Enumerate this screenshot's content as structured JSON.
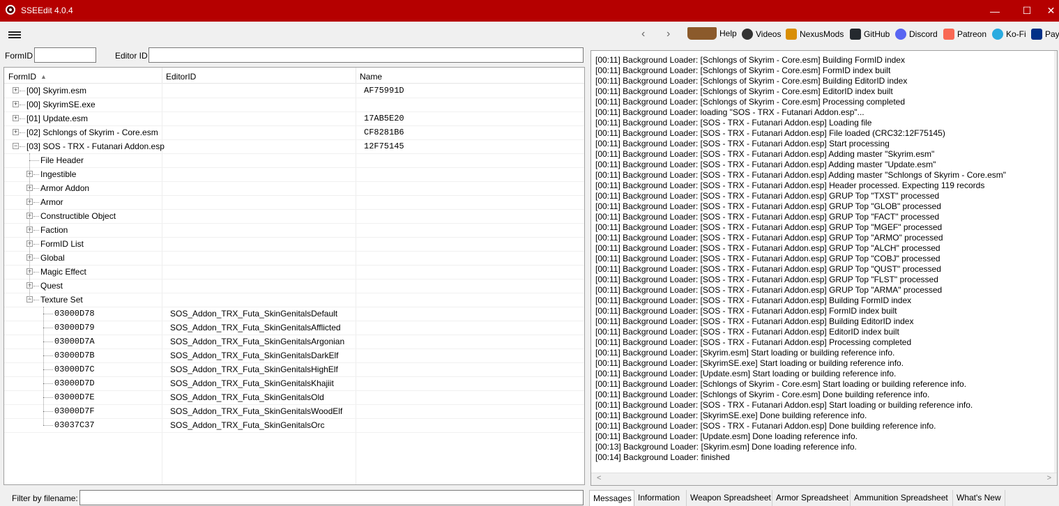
{
  "window": {
    "title": "SSEEdit 4.0.4",
    "minimize_label": "—",
    "maximize_label": "☐",
    "close_label": "✕"
  },
  "toolbar": {
    "back_label": "‹",
    "forward_label": "›",
    "links": [
      {
        "label": "Help",
        "icon": "book-icon",
        "color": "#8b5a2b"
      },
      {
        "label": "Videos",
        "icon": "videos-icon",
        "color": "#333333"
      },
      {
        "label": "NexusMods",
        "icon": "nexusmods-icon",
        "color": "#d98e04"
      },
      {
        "label": "GitHub",
        "icon": "github-icon",
        "color": "#24292e"
      },
      {
        "label": "Discord",
        "icon": "discord-icon",
        "color": "#5865f2"
      },
      {
        "label": "Patreon",
        "icon": "patreon-icon",
        "color": "#f96854"
      },
      {
        "label": "Ko-Fi",
        "icon": "kofi-icon",
        "color": "#29abe0"
      },
      {
        "label": "PayP",
        "icon": "paypal-icon",
        "color": "#003087"
      }
    ]
  },
  "filters": {
    "formid_label": "FormID",
    "formid_value": "",
    "editorid_label": "Editor ID",
    "editorid_value": "",
    "filename_label": "Filter by filename:",
    "filename_value": ""
  },
  "tree": {
    "columns": [
      "FormID",
      "EditorID",
      "Name"
    ],
    "sort_indicator": "▲",
    "files": [
      {
        "label": "[00] Skyrim.esm",
        "name": "AF75991D",
        "expanded": false
      },
      {
        "label": "[00] SkyrimSE.exe",
        "name": "",
        "expanded": false
      },
      {
        "label": "[01] Update.esm",
        "name": "17AB5E20",
        "expanded": false
      },
      {
        "label": "[02] Schlongs of Skyrim - Core.esm",
        "name": "CF8281B6",
        "expanded": false
      },
      {
        "label": "[03] SOS - TRX - Futanari Addon.esp",
        "name": "12F75145",
        "expanded": true
      }
    ],
    "groups": [
      {
        "label": "File Header",
        "expandable": false
      },
      {
        "label": "Ingestible",
        "expandable": true
      },
      {
        "label": "Armor Addon",
        "expandable": true
      },
      {
        "label": "Armor",
        "expandable": true
      },
      {
        "label": "Constructible Object",
        "expandable": true
      },
      {
        "label": "Faction",
        "expandable": true
      },
      {
        "label": "FormID List",
        "expandable": true
      },
      {
        "label": "Global",
        "expandable": true
      },
      {
        "label": "Magic Effect",
        "expandable": true
      },
      {
        "label": "Quest",
        "expandable": true
      },
      {
        "label": "Texture Set",
        "expandable": true,
        "expanded": true
      }
    ],
    "records": [
      {
        "formid": "03000D78",
        "editorid": "SOS_Addon_TRX_Futa_SkinGenitalsDefault"
      },
      {
        "formid": "03000D79",
        "editorid": "SOS_Addon_TRX_Futa_SkinGenitalsAfflicted"
      },
      {
        "formid": "03000D7A",
        "editorid": "SOS_Addon_TRX_Futa_SkinGenitalsArgonian"
      },
      {
        "formid": "03000D7B",
        "editorid": "SOS_Addon_TRX_Futa_SkinGenitalsDarkElf"
      },
      {
        "formid": "03000D7C",
        "editorid": "SOS_Addon_TRX_Futa_SkinGenitalsHighElf"
      },
      {
        "formid": "03000D7D",
        "editorid": "SOS_Addon_TRX_Futa_SkinGenitalsKhajiit"
      },
      {
        "formid": "03000D7E",
        "editorid": "SOS_Addon_TRX_Futa_SkinGenitalsOld"
      },
      {
        "formid": "03000D7F",
        "editorid": "SOS_Addon_TRX_Futa_SkinGenitalsWoodElf"
      },
      {
        "formid": "03037C37",
        "editorid": "SOS_Addon_TRX_Futa_SkinGenitalsOrc"
      }
    ]
  },
  "messages": [
    "[00:11] Background Loader: [Schlongs of Skyrim - Core.esm] Building FormID index",
    "[00:11] Background Loader: [Schlongs of Skyrim - Core.esm] FormID index built",
    "[00:11] Background Loader: [Schlongs of Skyrim - Core.esm] Building EditorID index",
    "[00:11] Background Loader: [Schlongs of Skyrim - Core.esm] EditorID index built",
    "[00:11] Background Loader: [Schlongs of Skyrim - Core.esm] Processing completed",
    "[00:11] Background Loader: loading \"SOS - TRX - Futanari Addon.esp\"...",
    "[00:11] Background Loader: [SOS - TRX - Futanari Addon.esp] Loading file",
    "[00:11] Background Loader: [SOS - TRX - Futanari Addon.esp] File loaded (CRC32:12F75145)",
    "[00:11] Background Loader: [SOS - TRX - Futanari Addon.esp] Start processing",
    "[00:11] Background Loader: [SOS - TRX - Futanari Addon.esp] Adding master \"Skyrim.esm\"",
    "[00:11] Background Loader: [SOS - TRX - Futanari Addon.esp] Adding master \"Update.esm\"",
    "[00:11] Background Loader: [SOS - TRX - Futanari Addon.esp] Adding master \"Schlongs of Skyrim - Core.esm\"",
    "[00:11] Background Loader: [SOS - TRX - Futanari Addon.esp] Header processed. Expecting 119 records",
    "[00:11] Background Loader: [SOS - TRX - Futanari Addon.esp] GRUP Top \"TXST\" processed",
    "[00:11] Background Loader: [SOS - TRX - Futanari Addon.esp] GRUP Top \"GLOB\" processed",
    "[00:11] Background Loader: [SOS - TRX - Futanari Addon.esp] GRUP Top \"FACT\" processed",
    "[00:11] Background Loader: [SOS - TRX - Futanari Addon.esp] GRUP Top \"MGEF\" processed",
    "[00:11] Background Loader: [SOS - TRX - Futanari Addon.esp] GRUP Top \"ARMO\" processed",
    "[00:11] Background Loader: [SOS - TRX - Futanari Addon.esp] GRUP Top \"ALCH\" processed",
    "[00:11] Background Loader: [SOS - TRX - Futanari Addon.esp] GRUP Top \"COBJ\" processed",
    "[00:11] Background Loader: [SOS - TRX - Futanari Addon.esp] GRUP Top \"QUST\" processed",
    "[00:11] Background Loader: [SOS - TRX - Futanari Addon.esp] GRUP Top \"FLST\" processed",
    "[00:11] Background Loader: [SOS - TRX - Futanari Addon.esp] GRUP Top \"ARMA\" processed",
    "[00:11] Background Loader: [SOS - TRX - Futanari Addon.esp] Building FormID index",
    "[00:11] Background Loader: [SOS - TRX - Futanari Addon.esp] FormID index built",
    "[00:11] Background Loader: [SOS - TRX - Futanari Addon.esp] Building EditorID index",
    "[00:11] Background Loader: [SOS - TRX - Futanari Addon.esp] EditorID index built",
    "[00:11] Background Loader: [SOS - TRX - Futanari Addon.esp] Processing completed",
    "[00:11] Background Loader: [Skyrim.esm] Start loading or building reference info.",
    "[00:11] Background Loader: [SkyrimSE.exe] Start loading or building reference info.",
    "[00:11] Background Loader: [Update.esm] Start loading or building reference info.",
    "[00:11] Background Loader: [Schlongs of Skyrim - Core.esm] Start loading or building reference info.",
    "[00:11] Background Loader: [Schlongs of Skyrim - Core.esm] Done building reference info.",
    "[00:11] Background Loader: [SOS - TRX - Futanari Addon.esp] Start loading or building reference info.",
    "[00:11] Background Loader: [SkyrimSE.exe] Done building reference info.",
    "[00:11] Background Loader: [SOS - TRX - Futanari Addon.esp] Done building reference info.",
    "[00:11] Background Loader: [Update.esm] Done loading reference info.",
    "[00:13] Background Loader: [Skyrim.esm] Done loading reference info.",
    "[00:14] Background Loader: finished"
  ],
  "scroll": {
    "left": "<",
    "right": ">"
  },
  "tabs": [
    {
      "label": "Messages",
      "active": true
    },
    {
      "label": "Information",
      "active": false
    },
    {
      "label": "Weapon Spreadsheet",
      "active": false
    },
    {
      "label": "Armor Spreadsheet",
      "active": false
    },
    {
      "label": "Ammunition Spreadsheet",
      "active": false
    },
    {
      "label": "What's New",
      "active": false
    }
  ]
}
